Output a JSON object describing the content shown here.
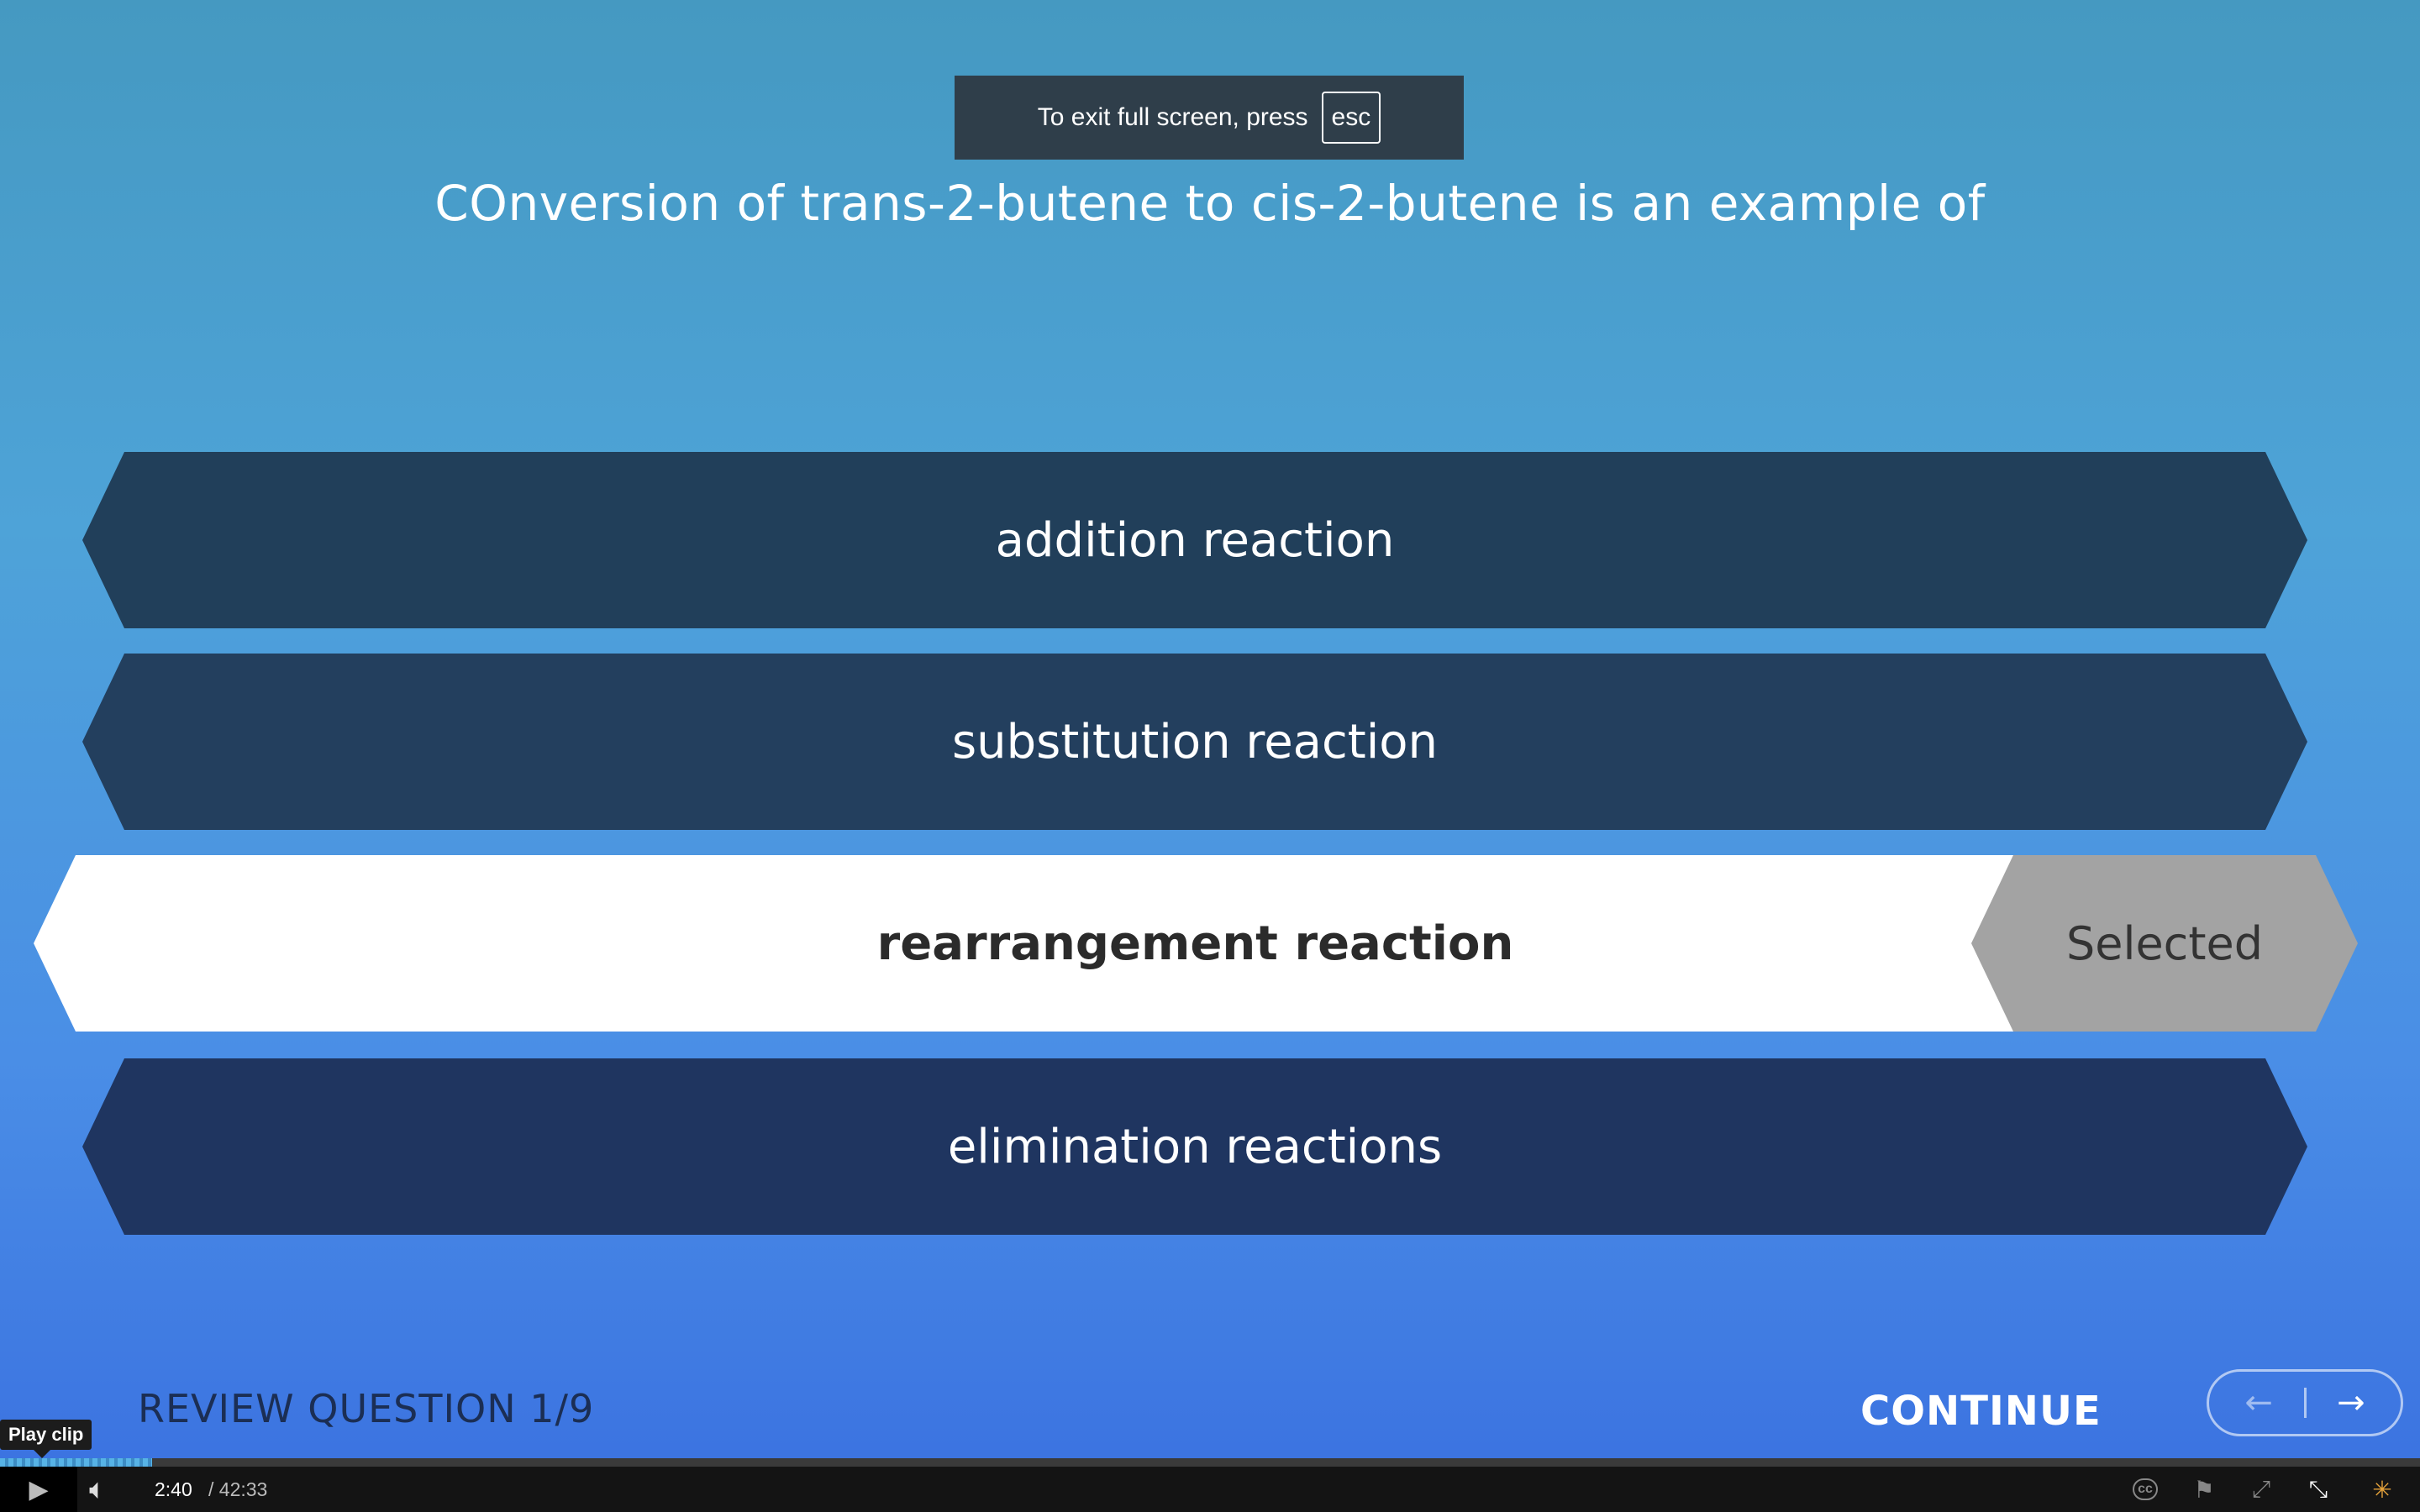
{
  "fullscreen_notice": {
    "text": "To exit full screen, press",
    "key": "esc"
  },
  "question": "COnversion of trans-2-butene to cis-2-butene is an example of",
  "options": [
    {
      "label": "addition reaction",
      "selected": false
    },
    {
      "label": "substitution reaction",
      "selected": false
    },
    {
      "label": "rearrangement reaction",
      "selected": true
    },
    {
      "label": "elimination reactions",
      "selected": false
    }
  ],
  "selected_badge": "Selected",
  "footer": {
    "review_label": "REVIEW QUESTION 1/9",
    "continue_label": "CONTINUE",
    "prev_arrow": "←",
    "next_arrow": "→"
  },
  "player": {
    "tooltip": "Play clip",
    "current_time": "2:40",
    "total_time": "/ 42:33",
    "progress_fraction": 0.063,
    "cc_label": "cc",
    "icons": [
      "play-icon",
      "volume-icon",
      "closed-captions-icon",
      "flag-icon",
      "fullscreen-icon",
      "exit-fullscreen-icon",
      "logo-icon"
    ]
  },
  "colors": {
    "option_dark": "#213f5a",
    "selected_bg": "#ffffff",
    "selected_badge": "#a3a3a3",
    "review_text": "#1b2e54"
  }
}
